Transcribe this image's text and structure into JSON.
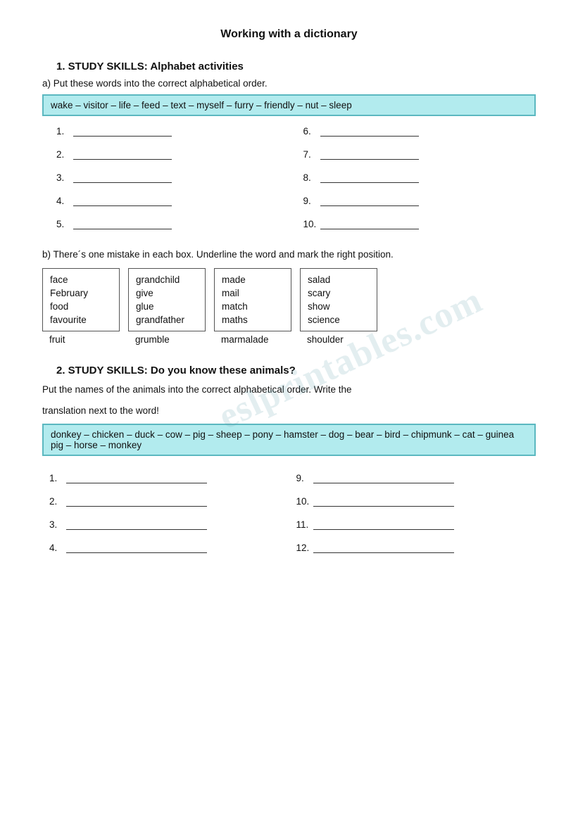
{
  "title": "Working with a dictionary",
  "section1": {
    "header": "1.  STUDY SKILLS: Alphabet activities",
    "parta": {
      "instruction": "a) Put these words into the correct alphabetical order.",
      "words": "wake – visitor – life – feed – text – myself – furry – friendly – nut – sleep",
      "lines": [
        {
          "num": "1.",
          "label": "line1"
        },
        {
          "num": "2.",
          "label": "line2"
        },
        {
          "num": "3.",
          "label": "line3"
        },
        {
          "num": "4.",
          "label": "line4"
        },
        {
          "num": "5.",
          "label": "line5"
        }
      ],
      "lines_right": [
        {
          "num": "6.",
          "label": "line6"
        },
        {
          "num": "7.",
          "label": "line7"
        },
        {
          "num": "8.",
          "label": "line8"
        },
        {
          "num": "9.",
          "label": "line9"
        },
        {
          "num": "10.",
          "label": "line10"
        }
      ]
    },
    "partb": {
      "instruction": "b) There´s one mistake in each box. Underline the word and mark the right position.",
      "boxes": [
        {
          "inside": [
            "face",
            "February",
            "food",
            "favourite"
          ],
          "outside": "fruit"
        },
        {
          "inside": [
            "grandchild",
            "give",
            "glue",
            "grandfather"
          ],
          "outside": "grumble"
        },
        {
          "inside": [
            "made",
            "mail",
            "match",
            "maths"
          ],
          "outside": "marmalade"
        },
        {
          "inside": [
            "salad",
            "scary",
            "show",
            "science"
          ],
          "outside": "shoulder"
        }
      ]
    }
  },
  "section2": {
    "header": "2.  STUDY SKILLS: Do you know these animals?",
    "instruction1": "Put the names of the animals into the correct alphabetical order. Write the",
    "instruction2": "translation next to the word!",
    "words": "donkey – chicken – duck – cow – pig – sheep – pony – hamster – dog – bear – bird – chipmunk – cat – guinea pig – horse – monkey",
    "lines_left": [
      {
        "num": "1.",
        "label": "a-line1"
      },
      {
        "num": "2.",
        "label": "a-line2"
      },
      {
        "num": "3.",
        "label": "a-line3"
      },
      {
        "num": "4.",
        "label": "a-line4"
      }
    ],
    "lines_right": [
      {
        "num": "9.",
        "label": "a-line9"
      },
      {
        "num": "10.",
        "label": "a-line10"
      },
      {
        "num": "11.",
        "label": "a-line11"
      },
      {
        "num": "12.",
        "label": "a-line12"
      }
    ]
  },
  "watermark": "eslprintables.com"
}
